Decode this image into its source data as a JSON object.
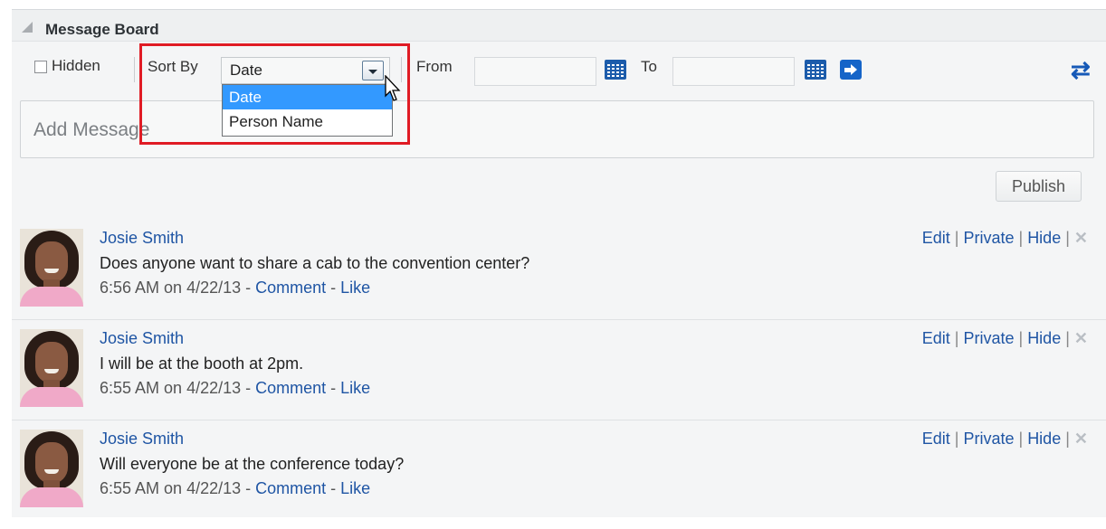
{
  "panel": {
    "title": "Message Board"
  },
  "toolbar": {
    "hidden_label": "Hidden",
    "sort_label": "Sort By",
    "sort_value": "Date",
    "from_label": "From",
    "to_label": "To"
  },
  "dropdown": {
    "options": [
      "Date",
      "Person Name"
    ],
    "selected": "Date"
  },
  "composer": {
    "placeholder": "Add Message",
    "publish_label": "Publish"
  },
  "posts": [
    {
      "author": "Josie Smith",
      "text": "Does anyone want to share a cab to the convention center?",
      "time": "6:56 AM on 4/22/13",
      "comment": "Comment",
      "like": "Like",
      "edit": "Edit",
      "private": "Private",
      "hide": "Hide"
    },
    {
      "author": "Josie Smith",
      "text": "I will be at the booth at 2pm.",
      "time": "6:55 AM on 4/22/13",
      "comment": "Comment",
      "like": "Like",
      "edit": "Edit",
      "private": "Private",
      "hide": "Hide"
    },
    {
      "author": "Josie Smith",
      "text": "Will everyone be at the conference today?",
      "time": "6:55 AM on 4/22/13",
      "comment": "Comment",
      "like": "Like",
      "edit": "Edit",
      "private": "Private",
      "hide": "Hide"
    }
  ],
  "icons": {
    "collapse": "triangle-collapse-icon",
    "calendar": "calendar-icon",
    "go": "arrow-right-icon",
    "refresh": "refresh-icon",
    "delete": "close-x-icon"
  },
  "colors": {
    "link": "#1f55a4",
    "highlight": "#e01b24",
    "selected": "#3399ff",
    "icon_blue": "#1c5cab"
  }
}
